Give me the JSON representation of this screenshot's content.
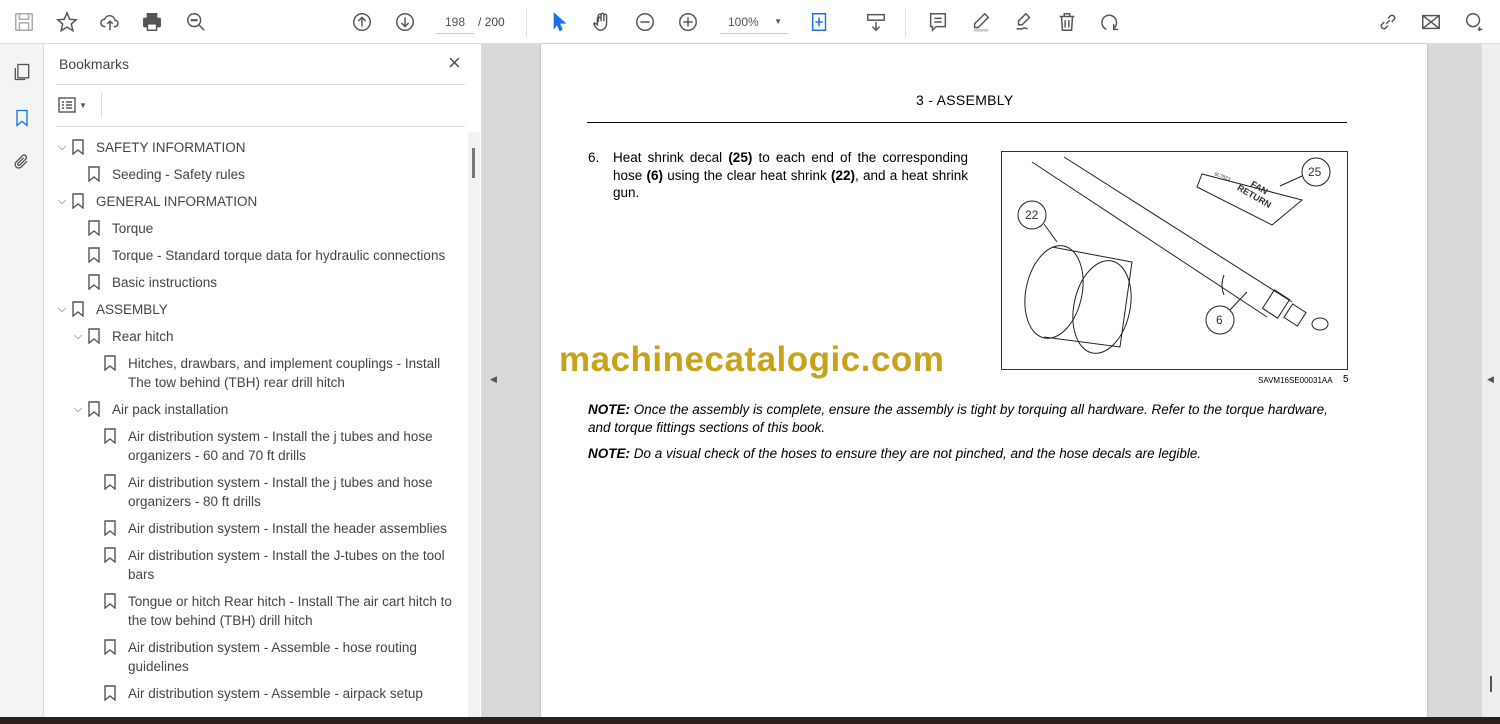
{
  "toolbar": {
    "current_page": "198",
    "total_pages": "/ 200",
    "zoom": "100%"
  },
  "bookmarks_panel": {
    "title": "Bookmarks",
    "close": "×",
    "items": [
      {
        "label": "SAFETY INFORMATION",
        "level": 0,
        "expanded": true
      },
      {
        "label": "Seeding - Safety rules",
        "level": 1
      },
      {
        "label": "GENERAL INFORMATION",
        "level": 0,
        "expanded": true
      },
      {
        "label": "Torque",
        "level": 1
      },
      {
        "label": "Torque - Standard torque data for hydraulic connections",
        "level": 1
      },
      {
        "label": "Basic instructions",
        "level": 1
      },
      {
        "label": "ASSEMBLY",
        "level": 0,
        "expanded": true
      },
      {
        "label": "Rear hitch",
        "level": 1,
        "expanded": true
      },
      {
        "label": "Hitches, drawbars, and implement couplings - Install The tow behind (TBH) rear drill hitch",
        "level": 2
      },
      {
        "label": "Air pack installation",
        "level": 1,
        "expanded": true
      },
      {
        "label": "Air distribution system - Install the j tubes and hose organizers - 60 and 70 ft drills",
        "level": 2
      },
      {
        "label": "Air distribution system - Install the j tubes and hose organizers - 80 ft drills",
        "level": 2
      },
      {
        "label": "Air distribution system - Install the header assemblies",
        "level": 2
      },
      {
        "label": "Air distribution system - Install the J-tubes on the tool bars",
        "level": 2
      },
      {
        "label": "Tongue or hitch Rear hitch - Install The air cart hitch to the tow behind (TBH) drill hitch",
        "level": 2
      },
      {
        "label": "Air distribution system - Assemble - hose routing guidelines",
        "level": 2
      },
      {
        "label": "Air distribution system - Assemble - airpack setup",
        "level": 2
      }
    ]
  },
  "document": {
    "header": "3 - ASSEMBLY",
    "step_number": "6.",
    "step_text_parts": [
      "Heat shrink decal ",
      "(25)",
      " to each end of the corresponding hose ",
      "(6)",
      " using the clear heat shrink ",
      "(22)",
      ", and a heat shrink gun."
    ],
    "figure": {
      "callouts": [
        "25",
        "22",
        "6"
      ],
      "decal_text": [
        "FAN",
        "RETURN"
      ],
      "decal_code": "9L7823",
      "caption": "SAVM16SE00031AA",
      "number": "5"
    },
    "watermark": "machinecatalogic.com",
    "notes": [
      {
        "label": "NOTE:",
        "text": " Once the assembly is complete, ensure the assembly is tight by torquing all hardware.  Refer to the torque hardware, and torque fittings sections of this book."
      },
      {
        "label": "NOTE:",
        "text": " Do a visual check of the hoses to ensure they are not pinched, and the hose decals are legible."
      }
    ]
  },
  "colors": {
    "accent": "#1473e6",
    "watermark": "#c9a21a"
  }
}
